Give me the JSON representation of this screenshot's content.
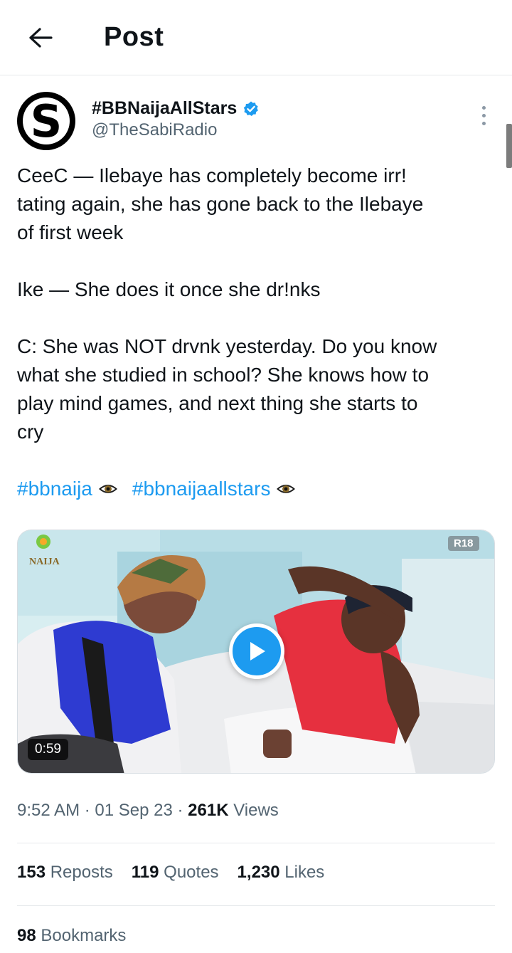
{
  "header": {
    "title": "Post",
    "back_icon": "arrow-left-icon"
  },
  "author": {
    "display_name": "#BBNaijaAllStars",
    "handle": "@TheSabiRadio",
    "avatar_letter": "S",
    "verified_color": "#1d9bf0"
  },
  "tweet": {
    "text": "CeeC — Ilebaye has completely become irr!\ntating again, she has gone back to the Ilebaye\nof first week\n\nIke — She does it once she dr!nks\n\nC: She was NOT drvnk yesterday. Do you know\nwhat she studied in school? She knows how to\nplay mind games, and next thing she starts to\ncry",
    "hashtags": [
      "#bbnaija",
      "#bbnaijaallstars"
    ]
  },
  "media": {
    "duration": "0:59",
    "rating": "R18",
    "logo_text": "NAIJA"
  },
  "meta": {
    "time": "9:52 AM",
    "date": "01 Sep 23",
    "views_count": "261K",
    "views_label": "Views"
  },
  "stats": {
    "reposts_count": "153",
    "reposts_label": "Reposts",
    "quotes_count": "119",
    "quotes_label": "Quotes",
    "likes_count": "1,230",
    "likes_label": "Likes",
    "bookmarks_count": "98",
    "bookmarks_label": "Bookmarks"
  },
  "colors": {
    "accent": "#1d9bf0",
    "text_primary": "#0f1419",
    "text_secondary": "#536471"
  }
}
